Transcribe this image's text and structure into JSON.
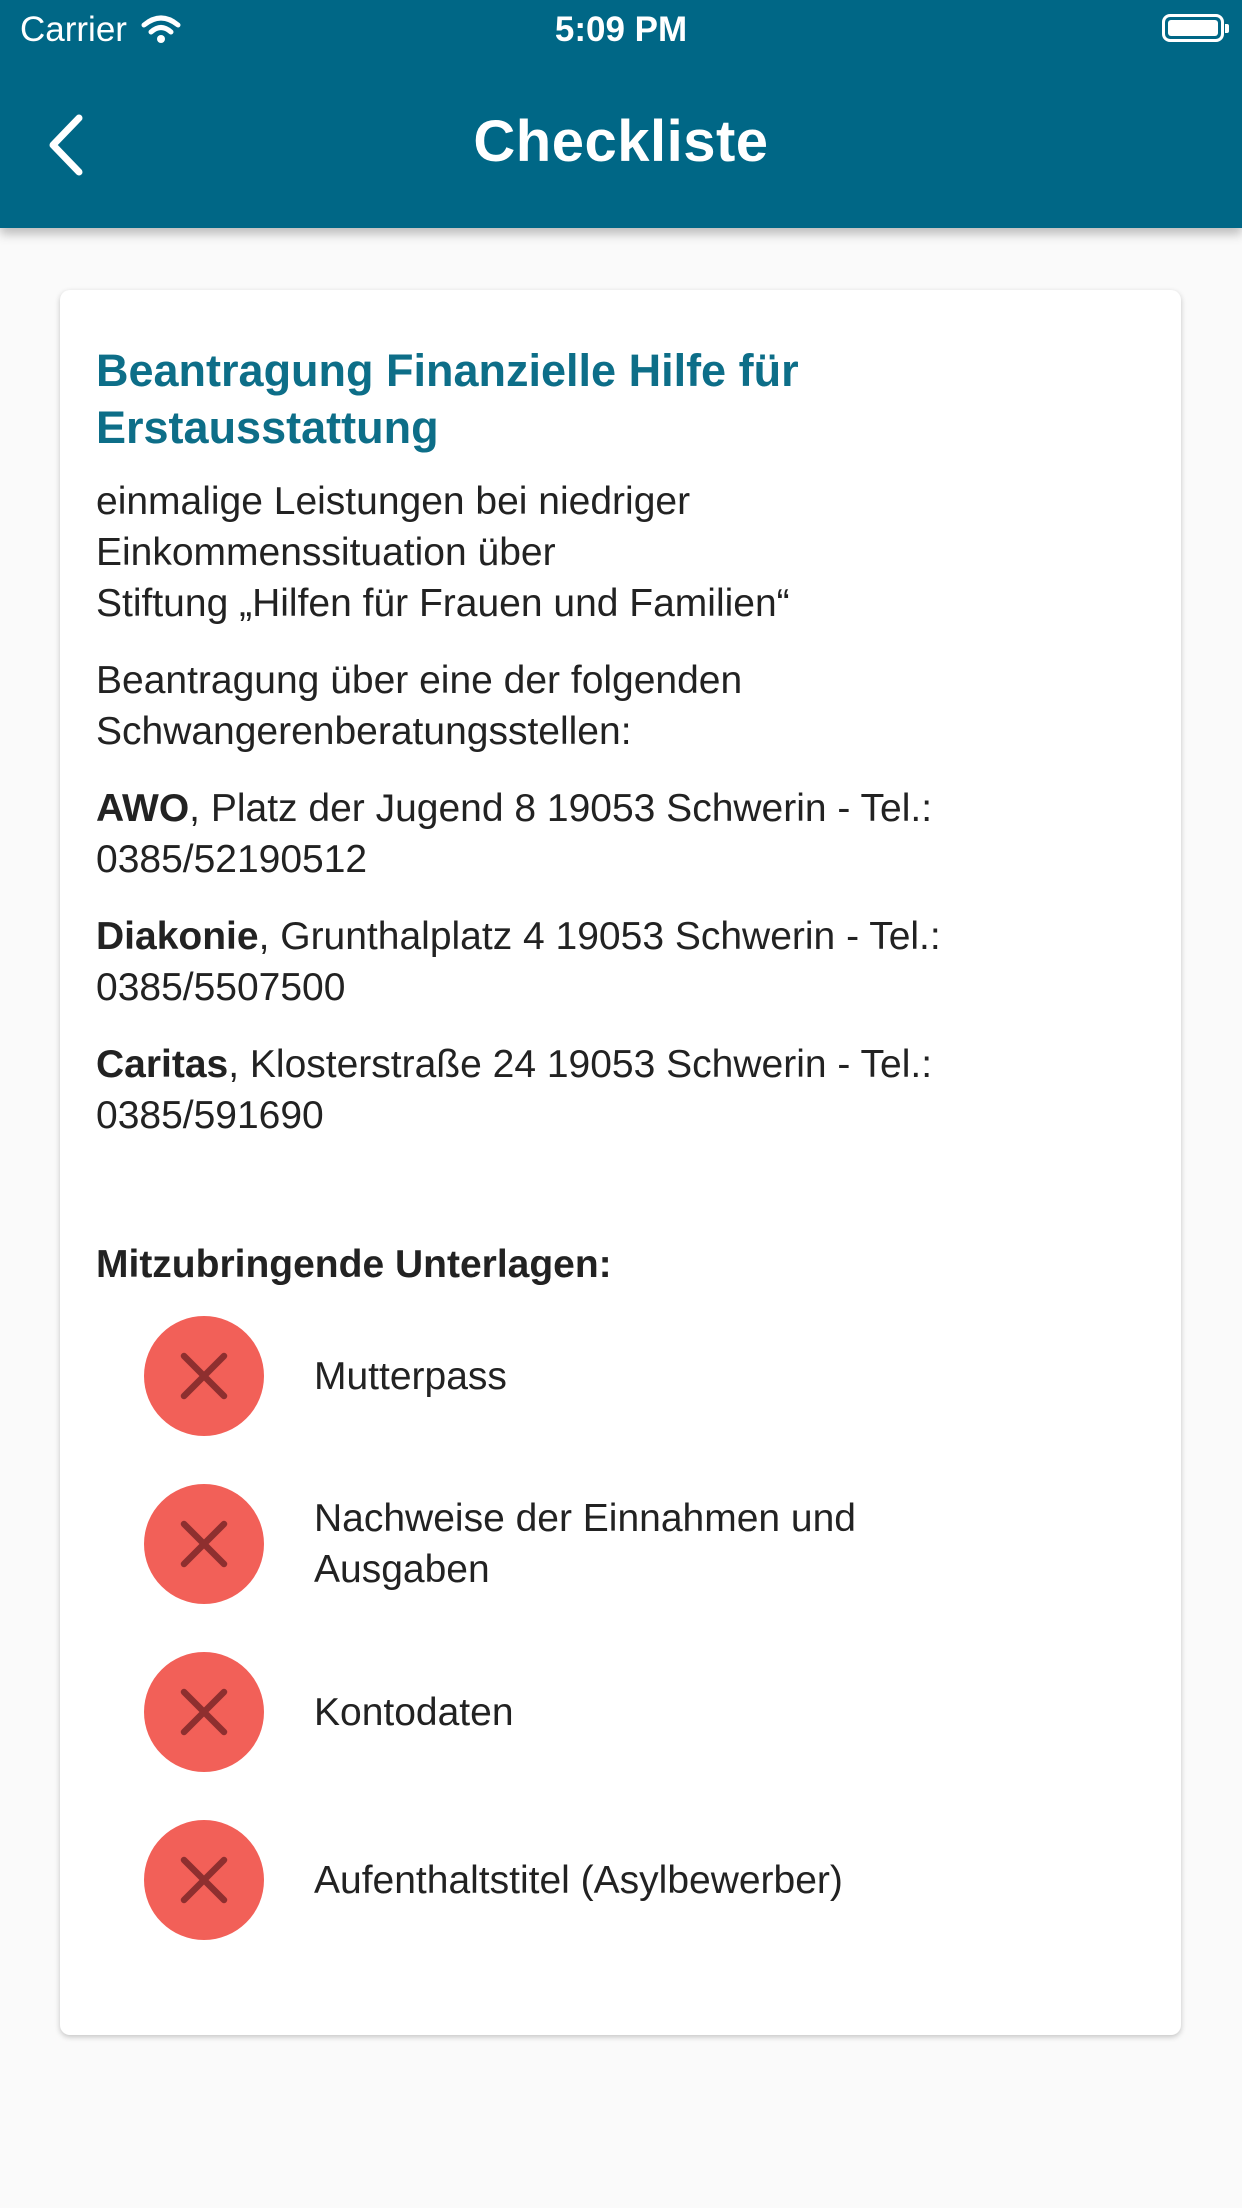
{
  "status_bar": {
    "carrier": "Carrier",
    "time": "5:09 PM"
  },
  "header": {
    "title": "Checkliste",
    "background_color": "#006786"
  },
  "card": {
    "title_line1": "Beantragung Finanzielle Hilfe für",
    "title_line2": "Erstausstattung",
    "intro_line1": "einmalige Leistungen bei niedriger",
    "intro_line2": "Einkommenssituation über",
    "intro_line3": "Stiftung „Hilfen für Frauen und Familien“",
    "application_line1": "Beantragung über eine der folgenden",
    "application_line2": "Schwangerenberatungsstellen:",
    "offices": [
      {
        "name": "AWO",
        "details_line1": ", Platz der Jugend 8 19053 Schwerin - Tel.:",
        "details_line2": "0385/52190512"
      },
      {
        "name": "Diakonie",
        "details_line1": ", Grunthalplatz 4 19053 Schwerin - Tel.:",
        "details_line2": "0385/5507500"
      },
      {
        "name": "Caritas",
        "details_line1": ", Klosterstraße 24 19053 Schwerin  - Tel.:",
        "details_line2": "0385/591690"
      }
    ],
    "documents_heading": "Mitzubringende Unterlagen:",
    "documents": [
      {
        "label_line1": "Mutterpass",
        "label_line2": "",
        "status": "missing",
        "icon": "close-icon"
      },
      {
        "label_line1": "Nachweise der Einnahmen und",
        "label_line2": "Ausgaben",
        "status": "missing",
        "icon": "close-icon"
      },
      {
        "label_line1": "Kontodaten",
        "label_line2": "",
        "status": "missing",
        "icon": "close-icon"
      },
      {
        "label_line1": "Aufenthaltstitel (Asylbewerber)",
        "label_line2": "",
        "status": "missing",
        "icon": "close-icon"
      }
    ],
    "title_color": "#0d6e88",
    "missing_status_color": "#f26058"
  }
}
